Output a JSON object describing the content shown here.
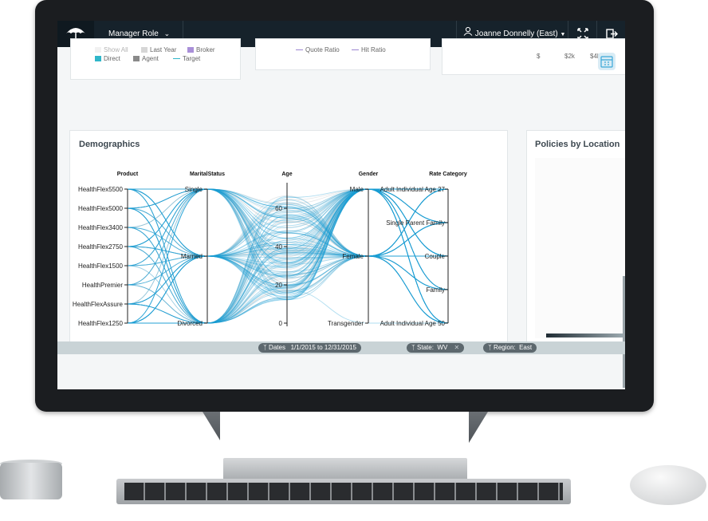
{
  "header": {
    "role_label": "Manager Role",
    "user_label": "Joanne Donnelly (East)"
  },
  "top_cards": {
    "legend_left": {
      "items": [
        {
          "label": "Show All",
          "color": "#e3e3e3"
        },
        {
          "label": "Last Year",
          "color": "#d6d6d6"
        },
        {
          "label": "Broker",
          "color": "#a98fd8"
        },
        {
          "label": "Direct",
          "color": "#2fb6c9"
        },
        {
          "label": "Agent",
          "color": "#8a8a8a"
        },
        {
          "label": "Target",
          "color": "#2fb6c9"
        }
      ]
    },
    "legend_middle": {
      "items": [
        {
          "label": "Quote Ratio",
          "color": "#9b86d1"
        },
        {
          "label": "Hit Ratio",
          "color": "#9b86d1"
        }
      ]
    },
    "axis_right": [
      "$",
      "$2k",
      "$4k"
    ]
  },
  "demographics": {
    "title": "Demographics"
  },
  "policies": {
    "title": "Policies by Location"
  },
  "chart_data": {
    "type": "parallel-coordinates",
    "title": "Demographics",
    "axes": [
      {
        "name": "Product",
        "categories": [
          "HealthFlex5500",
          "HealthFlex5000",
          "HealthFlex3400",
          "HealthFlex2750",
          "HealthFlex1500",
          "HealthPremier",
          "HealthFlexAssure",
          "HealthFlex1250"
        ]
      },
      {
        "name": "MaritalStatus",
        "categories": [
          "Single",
          "Married",
          "Divorced"
        ]
      },
      {
        "name": "Age",
        "ticks": [
          0,
          20,
          40,
          60
        ],
        "range": [
          0,
          80
        ]
      },
      {
        "name": "Gender",
        "categories": [
          "Male",
          "Female",
          "Transgender"
        ]
      },
      {
        "name": "Rate Category",
        "categories": [
          "Adult Individual Age 27",
          "Single Parent Family",
          "Couple",
          "Family",
          "Adult Individual Age 50"
        ]
      }
    ],
    "line_color": "#1a9fd4",
    "context_color": "#c8d0d4"
  },
  "filters": [
    {
      "label": "Dates",
      "value": "1/1/2015 to 12/31/2015"
    },
    {
      "label": "State:",
      "value": "WV"
    },
    {
      "label": "Region:",
      "value": "East"
    }
  ]
}
